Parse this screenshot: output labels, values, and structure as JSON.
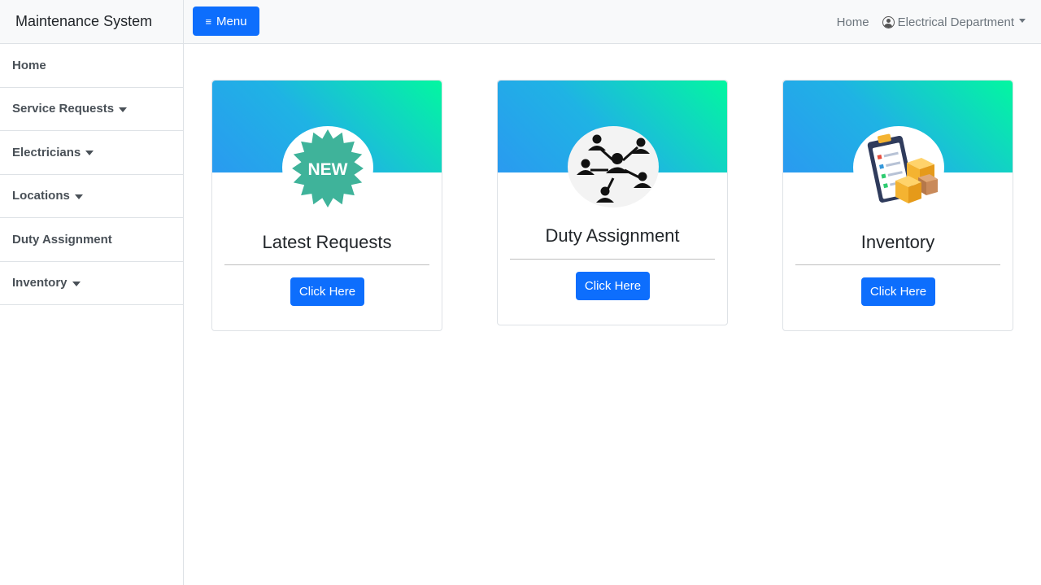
{
  "sidebar": {
    "brand": "Maintenance System",
    "items": [
      {
        "label": "Home",
        "has_dropdown": false
      },
      {
        "label": "Service Requests",
        "has_dropdown": true
      },
      {
        "label": "Electricians",
        "has_dropdown": true
      },
      {
        "label": "Locations",
        "has_dropdown": true
      },
      {
        "label": "Duty Assignment",
        "has_dropdown": false
      },
      {
        "label": "Inventory",
        "has_dropdown": true
      }
    ]
  },
  "topbar": {
    "menu_label": "Menu",
    "menu_icon": "hamburger-icon",
    "home_link": "Home",
    "user_label": "Electrical Department",
    "user_icon": "user-circle-icon"
  },
  "cards": [
    {
      "title": "Latest Requests",
      "icon": "new-badge-icon",
      "badge_text": "NEW",
      "button_label": "Click Here"
    },
    {
      "title": "Duty Assignment",
      "icon": "people-network-icon",
      "button_label": "Click Here"
    },
    {
      "title": "Inventory",
      "icon": "clipboard-boxes-icon",
      "button_label": "Click Here"
    }
  ],
  "colors": {
    "primary": "#0d6efd",
    "gradient_start": "#02f7a0",
    "gradient_end": "#2a9af0",
    "new_badge": "#3fb39a"
  }
}
